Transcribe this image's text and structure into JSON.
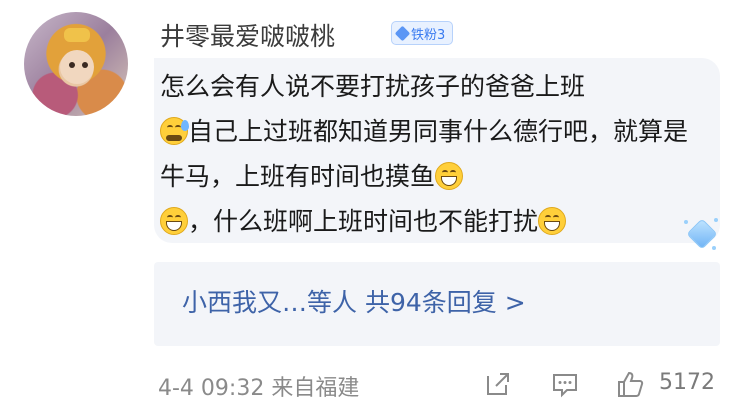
{
  "comment": {
    "username": "井零最爱啵啵桃",
    "badge": "铁粉3",
    "text_parts": [
      "怎么会有人说不要打扰孩子的爸爸上班",
      "自己上过班都知道男同事什么德行吧，就算是牛马，上班有时间也摸鱼",
      "，什么班啊上班时间也不能打扰"
    ],
    "emoji_icons": [
      "sweat-smile-icon",
      "grin-icon",
      "grin-icon",
      "grin-icon"
    ]
  },
  "replies": {
    "summary": "小西我又…等人 共94条回复 >"
  },
  "footer": {
    "time_location": "4-4 09:32 来自福建",
    "like_count": "5172"
  },
  "colors": {
    "link": "#3e63a8",
    "bubble": "#f3f5f9",
    "badge": "#3a7bf0"
  }
}
